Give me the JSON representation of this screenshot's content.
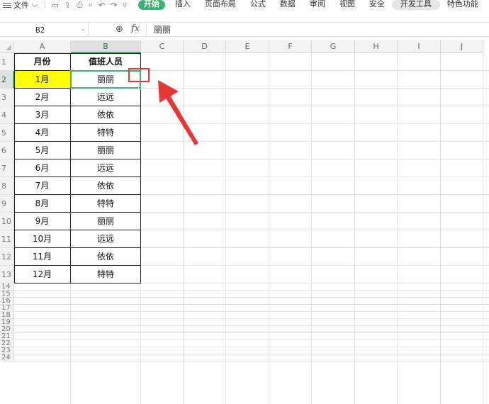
{
  "ribbon": {
    "file_label": "文件",
    "file_arrow": "⌵",
    "quick_icons": [
      "save-icon",
      "export-icon",
      "print-icon",
      "preview-icon",
      "undo-icon",
      "redo-icon",
      "more-icon"
    ],
    "tabs": [
      {
        "label": "开始",
        "style": "active"
      },
      {
        "label": "插入",
        "style": "normal"
      },
      {
        "label": "页面布局",
        "style": "normal"
      },
      {
        "label": "公式",
        "style": "normal"
      },
      {
        "label": "数据",
        "style": "normal"
      },
      {
        "label": "审阅",
        "style": "normal"
      },
      {
        "label": "视图",
        "style": "normal"
      },
      {
        "label": "安全",
        "style": "normal"
      },
      {
        "label": "开发工具",
        "style": "pill"
      },
      {
        "label": "特色功能",
        "style": "normal"
      }
    ],
    "accent_color": "#3cb371"
  },
  "formula_bar": {
    "name_box": "B2",
    "fx_label": "fx",
    "value": "丽丽"
  },
  "sheet": {
    "columns": [
      "A",
      "B",
      "C",
      "D",
      "E",
      "F",
      "G",
      "H",
      "I",
      "J"
    ],
    "selected_column": "B",
    "rows": [
      "1",
      "2",
      "3",
      "4",
      "5",
      "6",
      "7",
      "8",
      "9",
      "10",
      "11",
      "12",
      "13",
      "14",
      "15",
      "16",
      "17",
      "18",
      "19",
      "20",
      "21",
      "22",
      "23",
      "24"
    ],
    "selected_row": "2",
    "header": {
      "a": "月份",
      "b": "值班人员"
    },
    "data": [
      {
        "month": "1月",
        "person": "丽丽"
      },
      {
        "month": "2月",
        "person": "远远"
      },
      {
        "month": "3月",
        "person": "依依"
      },
      {
        "month": "4月",
        "person": "特特"
      },
      {
        "month": "5月",
        "person": "丽丽"
      },
      {
        "month": "6月",
        "person": "远远"
      },
      {
        "month": "7月",
        "person": "依依"
      },
      {
        "month": "8月",
        "person": "特特"
      },
      {
        "month": "9月",
        "person": "丽丽"
      },
      {
        "month": "10月",
        "person": "远远"
      },
      {
        "month": "11月",
        "person": "依依"
      },
      {
        "month": "12月",
        "person": "特特"
      }
    ],
    "highlight_color": "#ffff00",
    "annotation_color": "#e53935"
  }
}
